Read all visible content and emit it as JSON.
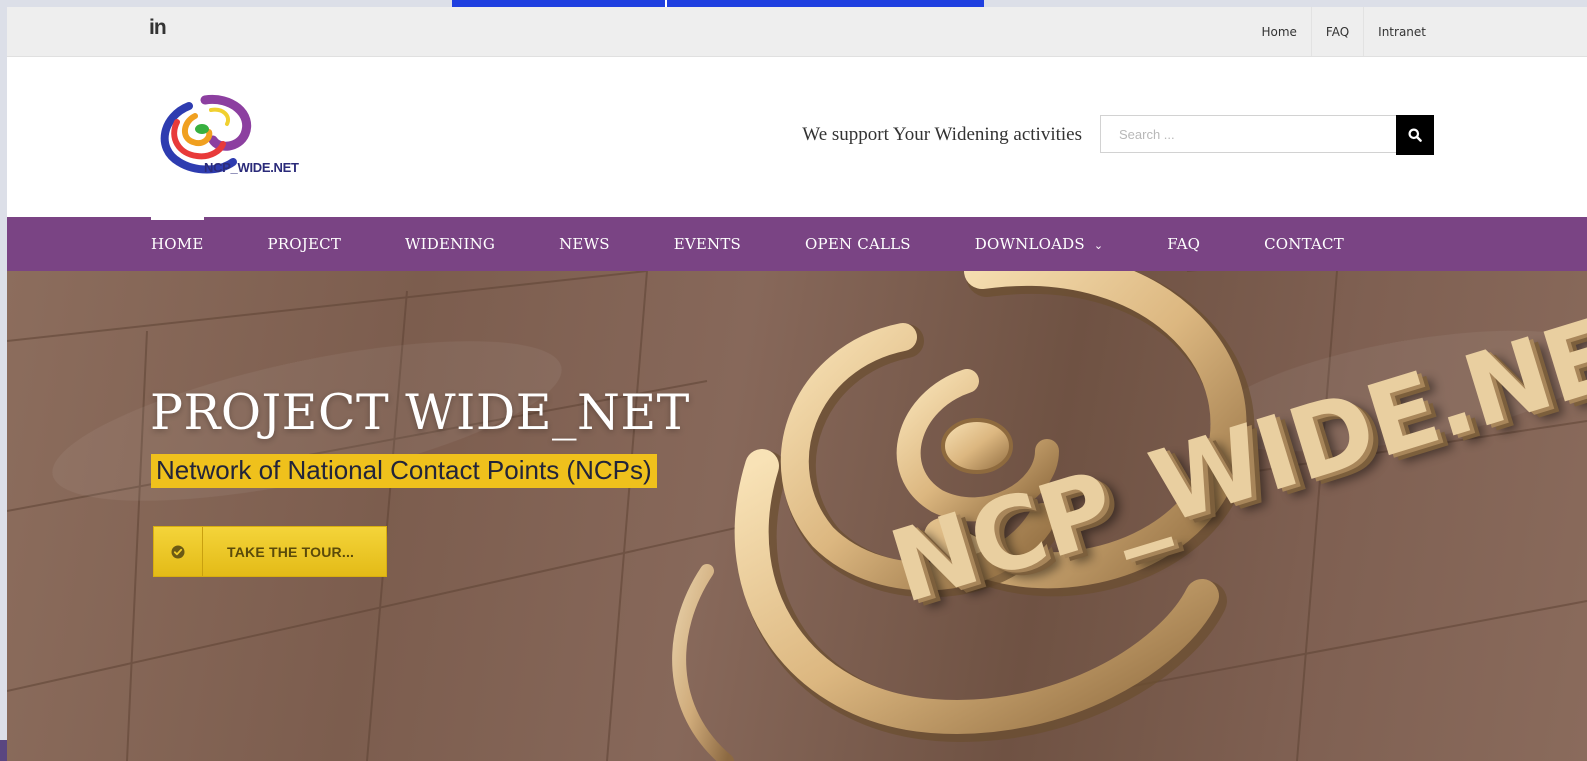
{
  "utility_bar": {
    "social_icon": "linkedin-icon",
    "social_text": "in",
    "links": [
      "Home",
      "FAQ",
      "Intranet"
    ]
  },
  "header": {
    "logo_text": "NCP_WIDE.NET",
    "tagline": "We support Your Widening activities",
    "search": {
      "placeholder": "Search ...",
      "icon": "search-icon"
    }
  },
  "main_nav": {
    "items": [
      {
        "label": "HOME",
        "active": true
      },
      {
        "label": "PROJECT"
      },
      {
        "label": "WIDENING"
      },
      {
        "label": "NEWS"
      },
      {
        "label": "EVENTS"
      },
      {
        "label": "OPEN CALLS"
      },
      {
        "label": "DOWNLOADS",
        "has_dropdown": true
      },
      {
        "label": "FAQ"
      },
      {
        "label": "CONTACT"
      }
    ],
    "background_color": "#7a4484"
  },
  "hero": {
    "title": "PROJECT WIDE_NET",
    "subtitle": "Network of National Contact Points (NCPs)",
    "cta_label": "TAKE THE TOUR...",
    "cta_icon": "check-circle-icon",
    "brand_text": "NCP_WIDE.NE",
    "accent_color": "#efc11c"
  }
}
